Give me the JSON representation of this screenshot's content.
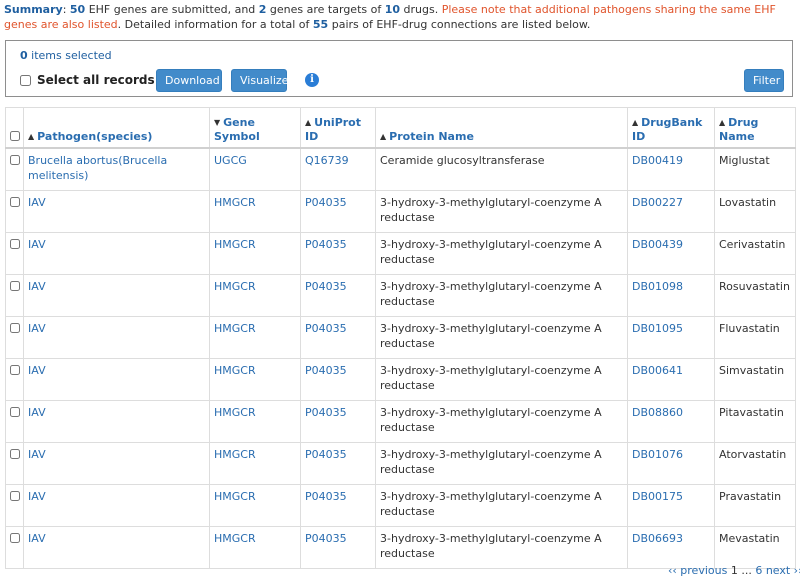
{
  "summary": {
    "label": "Summary",
    "p1": ": ",
    "genes_submitted": "50",
    "p2": " EHF genes are submitted, and ",
    "genes_targets": "2",
    "p3": " genes are targets of ",
    "drugs": "10",
    "p4": " drugs. ",
    "warning": "Please note that additional pathogens sharing the same EHF genes are also listed",
    "p5": ". Detailed information for a total of ",
    "pairs": "55",
    "p6": " pairs of EHF-drug connections are listed below."
  },
  "toolbar": {
    "selected_count": "0",
    "selected_suffix": " items selected",
    "select_all_label": "Select all records",
    "download_label": "Download",
    "visualize_label": "Visualize",
    "info_icon": "i",
    "filter_label": "Filter"
  },
  "table": {
    "headers": {
      "pathogen": "Pathogen(species)",
      "gene": "Gene Symbol",
      "uniprot": "UniProt ID",
      "protein": "Protein Name",
      "drugbank": "DrugBank ID",
      "drug": "Drug Name"
    },
    "rows": [
      {
        "pathogen": "Brucella abortus(Brucella melitensis)",
        "gene": "UGCG",
        "uniprot": "Q16739",
        "protein": "Ceramide glucosyltransferase",
        "drugbank": "DB00419",
        "drug": "Miglustat"
      },
      {
        "pathogen": "IAV",
        "gene": "HMGCR",
        "uniprot": "P04035",
        "protein": "3-hydroxy-3-methylglutaryl-coenzyme A reductase",
        "drugbank": "DB00227",
        "drug": "Lovastatin"
      },
      {
        "pathogen": "IAV",
        "gene": "HMGCR",
        "uniprot": "P04035",
        "protein": "3-hydroxy-3-methylglutaryl-coenzyme A reductase",
        "drugbank": "DB00439",
        "drug": "Cerivastatin"
      },
      {
        "pathogen": "IAV",
        "gene": "HMGCR",
        "uniprot": "P04035",
        "protein": "3-hydroxy-3-methylglutaryl-coenzyme A reductase",
        "drugbank": "DB01098",
        "drug": "Rosuvastatin"
      },
      {
        "pathogen": "IAV",
        "gene": "HMGCR",
        "uniprot": "P04035",
        "protein": "3-hydroxy-3-methylglutaryl-coenzyme A reductase",
        "drugbank": "DB01095",
        "drug": "Fluvastatin"
      },
      {
        "pathogen": "IAV",
        "gene": "HMGCR",
        "uniprot": "P04035",
        "protein": "3-hydroxy-3-methylglutaryl-coenzyme A reductase",
        "drugbank": "DB00641",
        "drug": "Simvastatin"
      },
      {
        "pathogen": "IAV",
        "gene": "HMGCR",
        "uniprot": "P04035",
        "protein": "3-hydroxy-3-methylglutaryl-coenzyme A reductase",
        "drugbank": "DB08860",
        "drug": "Pitavastatin"
      },
      {
        "pathogen": "IAV",
        "gene": "HMGCR",
        "uniprot": "P04035",
        "protein": "3-hydroxy-3-methylglutaryl-coenzyme A reductase",
        "drugbank": "DB01076",
        "drug": "Atorvastatin"
      },
      {
        "pathogen": "IAV",
        "gene": "HMGCR",
        "uniprot": "P04035",
        "protein": "3-hydroxy-3-methylglutaryl-coenzyme A reductase",
        "drugbank": "DB00175",
        "drug": "Pravastatin"
      },
      {
        "pathogen": "IAV",
        "gene": "HMGCR",
        "uniprot": "P04035",
        "protein": "3-hydroxy-3-methylglutaryl-coenzyme A reductase",
        "drugbank": "DB06693",
        "drug": "Mevastatin"
      }
    ]
  },
  "pagination": {
    "previous": "‹‹ previous",
    "pages": " 1 ... ",
    "last": "6",
    "next": "next ››"
  },
  "colors": {
    "link": "#2a6db0",
    "warning": "#e0542c",
    "button": "#428bca"
  }
}
